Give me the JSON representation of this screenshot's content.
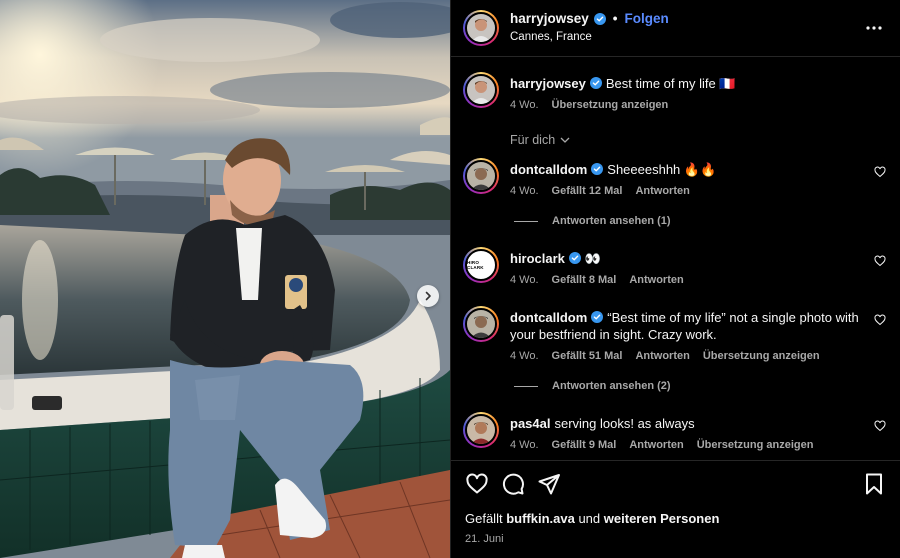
{
  "post_header": {
    "username": "harryjowsey",
    "separator": "•",
    "follow_label": "Folgen",
    "location": "Cannes, France"
  },
  "caption": {
    "username": "harryjowsey",
    "text": "Best time of my life 🇫🇷",
    "age": "4 Wo.",
    "translate_label": "Übersetzung anzeigen"
  },
  "filter": {
    "label": "Für dich"
  },
  "comments": [
    {
      "username": "dontcalldom",
      "verified": true,
      "text": "Sheeeeshhh 🔥🔥",
      "age": "4 Wo.",
      "likes": "Gefällt 12 Mal",
      "reply_label": "Antworten",
      "translate_label": "",
      "view_replies": "Antworten ansehen (1)"
    },
    {
      "username": "hiroclark",
      "verified": true,
      "text": "👀",
      "age": "4 Wo.",
      "likes": "Gefällt 8 Mal",
      "reply_label": "Antworten",
      "translate_label": "",
      "view_replies": ""
    },
    {
      "username": "dontcalldom",
      "verified": true,
      "text": "“Best time of my life” not a single photo with your bestfriend in sight. Crazy work.",
      "age": "4 Wo.",
      "likes": "Gefällt 51 Mal",
      "reply_label": "Antworten",
      "translate_label": "Übersetzung anzeigen",
      "view_replies": "Antworten ansehen (2)"
    },
    {
      "username": "pas4al",
      "verified": false,
      "text": "serving looks! as always",
      "age": "4 Wo.",
      "likes": "Gefällt 9 Mal",
      "reply_label": "Antworten",
      "translate_label": "Übersetzung anzeigen",
      "view_replies": ""
    }
  ],
  "hiroclark_avatar_text": "HIRO CLARK",
  "likes_line": {
    "prefix": "Gefällt",
    "user": "buffkin.ava",
    "middle": "und",
    "rest": "weiteren Personen"
  },
  "post_date": "21. Juni",
  "icons": [
    "heart-icon",
    "comment-icon",
    "share-icon",
    "bookmark-icon",
    "more-icon",
    "chevron-right-icon",
    "verified-icon"
  ],
  "colors": {
    "accent": "#5a8bff",
    "verified": "#3897f0",
    "muted": "#a8a8a8",
    "background": "#000000"
  }
}
